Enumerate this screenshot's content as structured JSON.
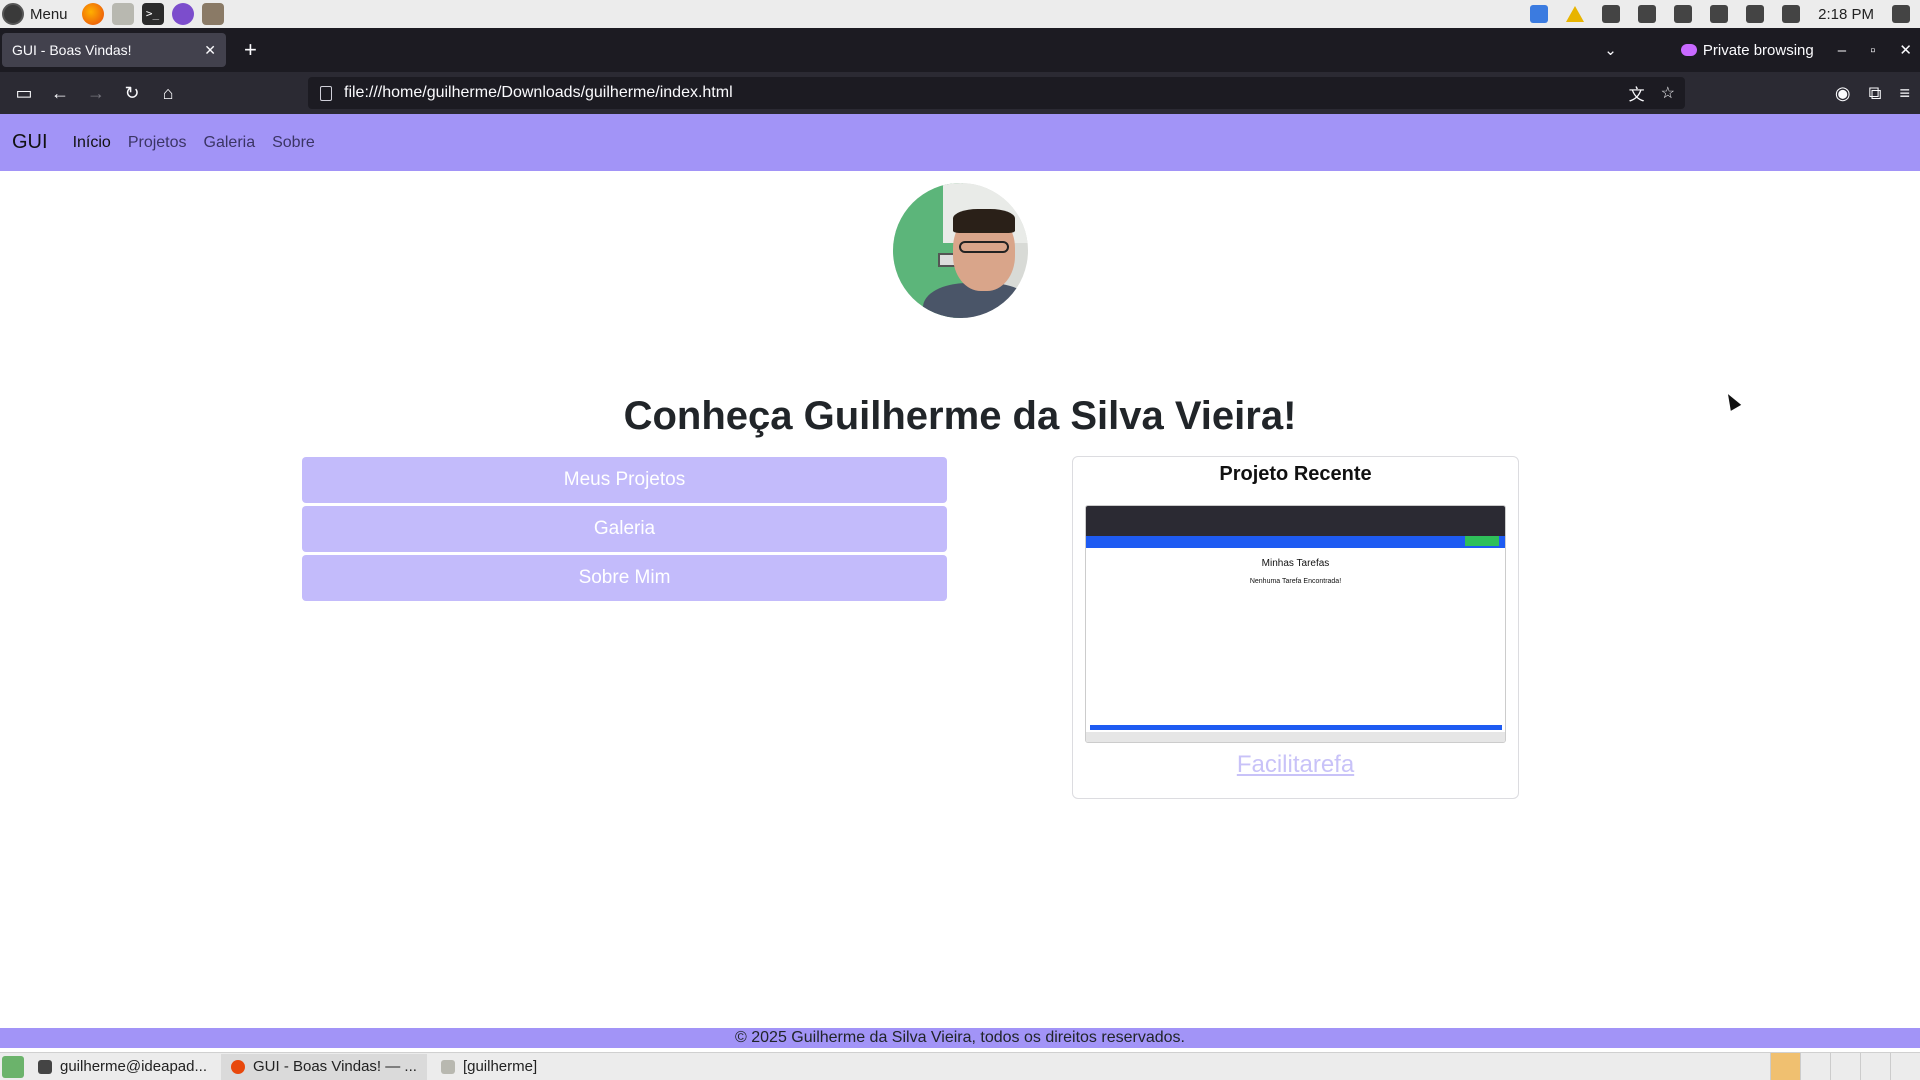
{
  "os": {
    "menu_label": "Menu",
    "clock": "2:18 PM",
    "launchers": [
      "firefox-icon",
      "files-icon",
      "terminal-icon",
      "emacs-icon",
      "gimp-icon"
    ],
    "terminal_glyph": ">_"
  },
  "browser": {
    "tab_title": "GUI - Boas Vindas!",
    "tab_close": "✕",
    "new_tab": "+",
    "private_label": "Private browsing",
    "url": "file:///home/guilherme/Downloads/guilherme/index.html",
    "window_controls": [
      "–",
      "▫",
      "✕"
    ],
    "tabs_dropdown": "⌄"
  },
  "site": {
    "brand": "GUI",
    "nav": [
      "Início",
      "Projetos",
      "Galeria",
      "Sobre"
    ],
    "headline": "Conheça Guilherme da Silva Vieira!",
    "buttons": [
      "Meus Projetos",
      "Galeria",
      "Sobre Mim"
    ],
    "card": {
      "title": "Projeto Recente",
      "preview_title": "Minhas Tarefas",
      "preview_subtitle": "Nenhuma Tarefa Encontrada!",
      "link": "Facilitarefa"
    },
    "footer": "© 2025 Guilherme da Silva Vieira, todos os direitos reservados."
  },
  "taskbar": {
    "tasks": [
      "guilherme@ideapad...",
      "GUI - Boas Vindas! — ...",
      "[guilherme]"
    ]
  },
  "colors": {
    "nav_bg": "#a294f7",
    "button_bg": "#c3bbfb",
    "link": "#c8c2f8"
  }
}
